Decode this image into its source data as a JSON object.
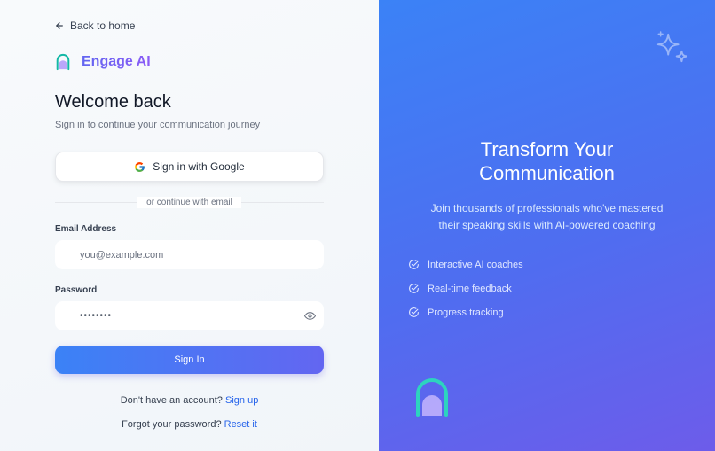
{
  "nav": {
    "back_label": "Back to home"
  },
  "brand": {
    "name": "Engage AI"
  },
  "login": {
    "title": "Welcome back",
    "subtitle": "Sign in to continue your communication journey",
    "google_label": "Sign in with Google",
    "divider_text": "or continue with email",
    "email_label": "Email Address",
    "email_placeholder": "you@example.com",
    "password_label": "Password",
    "password_value": "••••••••",
    "submit_label": "Sign In",
    "signup_prompt": "Don't have an account?",
    "signup_link": "Sign up",
    "forgot_prompt": "Forgot your password?",
    "forgot_link": "Reset it"
  },
  "hero": {
    "title_line1": "Transform Your",
    "title_line2": "Communication",
    "desc_line1": "Join thousands of professionals who've mastered",
    "desc_line2": "their speaking skills with AI-powered coaching",
    "features": [
      "Interactive AI coaches",
      "Real-time feedback",
      "Progress tracking"
    ]
  },
  "icons": {
    "back": "arrow-left-icon",
    "brand": "arch-logo-icon",
    "google": "google-icon",
    "eye": "eye-icon",
    "check": "check-circle-icon",
    "sparkle": "sparkle-icon"
  },
  "colors": {
    "accent": "#3b82f6",
    "brand_purple": "#8b5cf6",
    "link": "#2563eb",
    "hero_start": "#3b82f6",
    "hero_end": "#6d5cea"
  }
}
